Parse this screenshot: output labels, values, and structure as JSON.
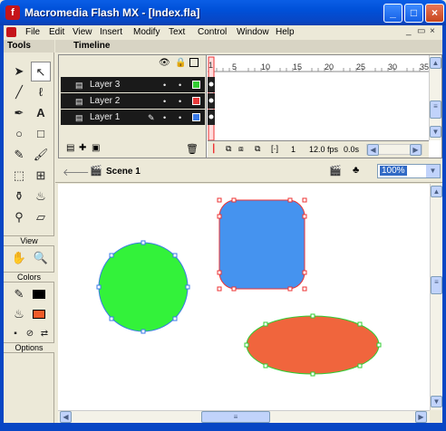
{
  "window": {
    "title": "Macromedia Flash MX - [Index.fla]",
    "app_icon": "f",
    "controls": [
      "_",
      "□",
      "×"
    ]
  },
  "menu": {
    "items": [
      "File",
      "Edit",
      "View",
      "Insert",
      "Modify",
      "Text",
      "Control",
      "Window",
      "Help"
    ],
    "mdi_controls": [
      "_",
      "▭",
      "×"
    ]
  },
  "tools": {
    "title": "Tools",
    "view_label": "View",
    "colors_label": "Colors",
    "options_label": "Options",
    "stroke_color": "#000000",
    "fill_color": "#f05a28"
  },
  "timeline": {
    "title": "Timeline",
    "ruler_numbers": [
      "1",
      "5",
      "10",
      "15",
      "20",
      "25",
      "30",
      "35"
    ],
    "layers": [
      {
        "name": "Layer 3",
        "color": "#33cc33"
      },
      {
        "name": "Layer 2",
        "color": "#e83a3a"
      },
      {
        "name": "Layer 1",
        "color": "#3a7ae8"
      }
    ],
    "current_frame": "1",
    "frame_rate": "12.0 fps",
    "elapsed": "0.0s"
  },
  "editbar": {
    "scene": "Scene 1",
    "zoom": "100%"
  },
  "stage": {
    "shapes": [
      {
        "name": "blue-rounded-square",
        "fill": "#4593ef"
      },
      {
        "name": "green-circle",
        "fill": "#33f23a"
      },
      {
        "name": "orange-ellipse",
        "fill": "#f0653d"
      }
    ]
  }
}
